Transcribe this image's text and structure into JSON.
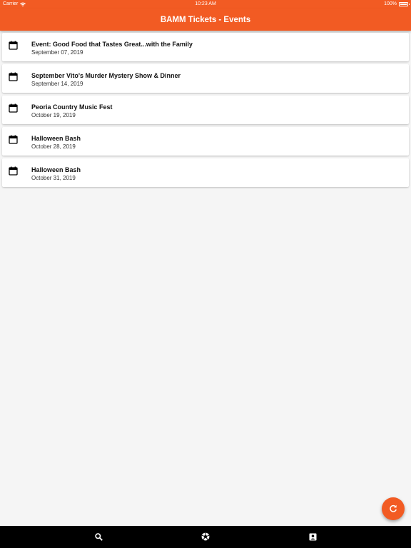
{
  "status_bar": {
    "carrier": "Carrier",
    "time": "10:23 AM",
    "battery": "100%"
  },
  "app_bar": {
    "title": "BAMM Tickets - Events"
  },
  "events": [
    {
      "title": "Event: Good Food that Tastes Great...with the Family",
      "date": "September 07, 2019",
      "icon": "calendar-icon"
    },
    {
      "title": "September Vito's Murder Mystery Show & Dinner",
      "date": "September 14, 2019",
      "icon": "calendar-icon"
    },
    {
      "title": "Peoria Country Music Fest",
      "date": "October 19, 2019",
      "icon": "calendar-icon"
    },
    {
      "title": "Halloween Bash",
      "date": "October 28, 2019",
      "icon": "calendar-icon"
    },
    {
      "title": "Halloween Bash",
      "date": "October 31, 2019",
      "icon": "calendar-icon"
    }
  ],
  "fab": {
    "icon": "refresh-icon"
  },
  "bottom_nav": {
    "items": [
      {
        "icon": "search-icon"
      },
      {
        "icon": "camera-shutter-icon"
      },
      {
        "icon": "contact-card-icon"
      }
    ]
  },
  "colors": {
    "accent": "#f25b23",
    "background": "#f5f5f5",
    "bottom_nav": "#000000"
  }
}
